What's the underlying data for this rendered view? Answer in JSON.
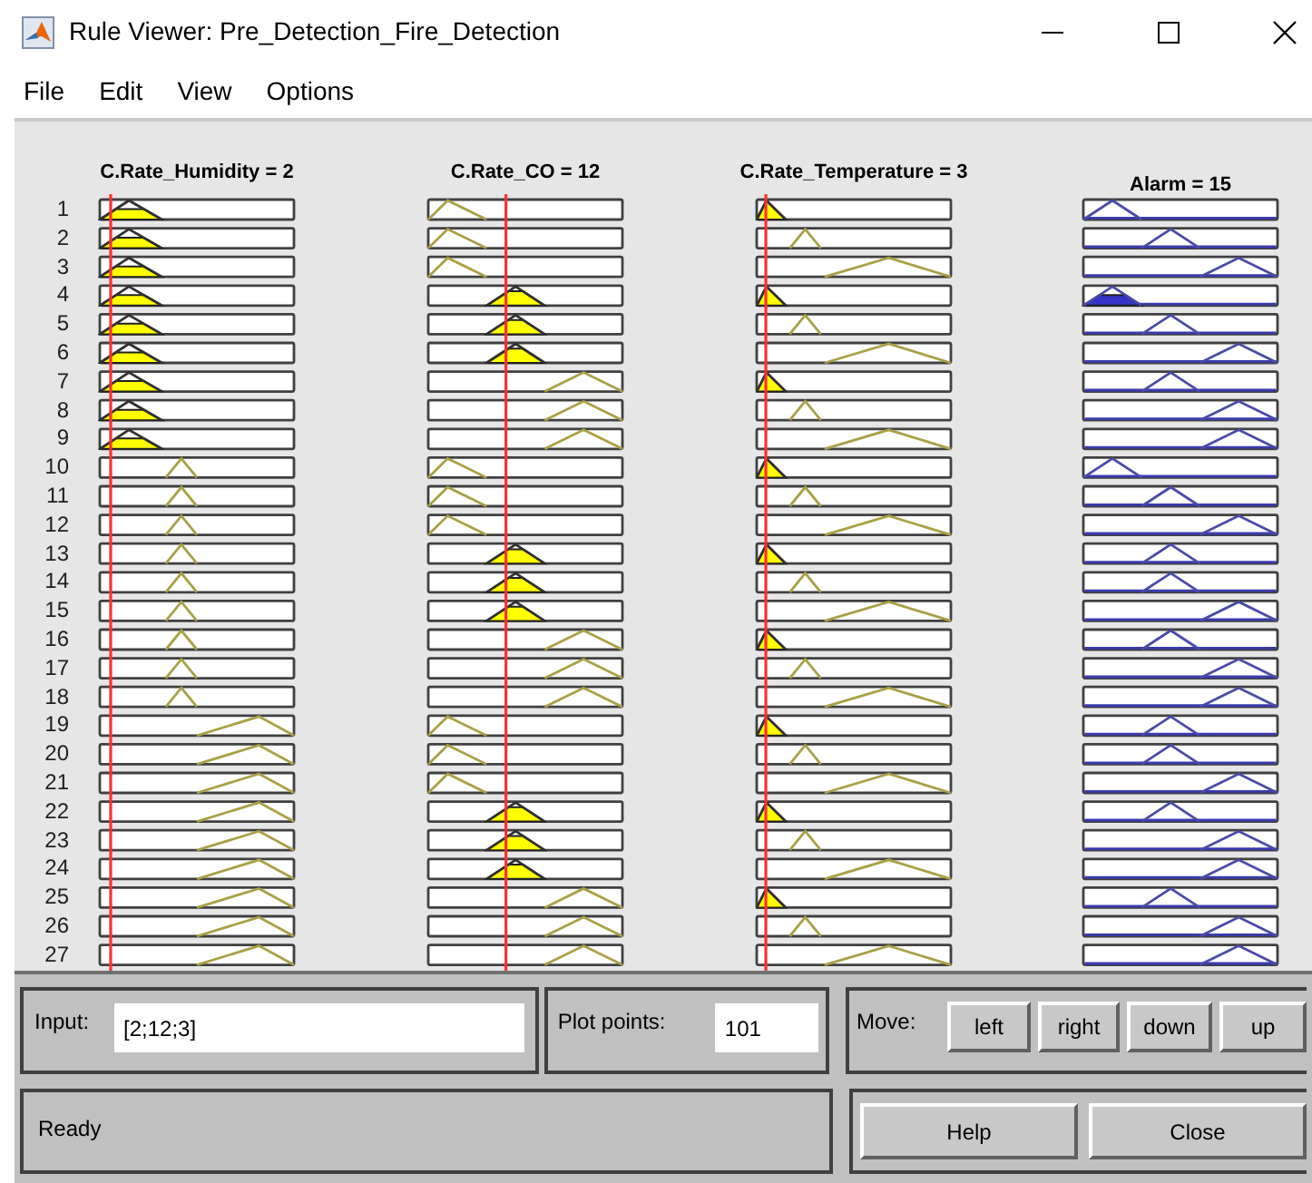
{
  "window": {
    "title": "Rule Viewer: Pre_Detection_Fire_Detection"
  },
  "menu": [
    "File",
    "Edit",
    "View",
    "Options"
  ],
  "columns": [
    {
      "title": "C.Rate_Humidity = 2",
      "input_line": true
    },
    {
      "title": "C.Rate_CO = 12",
      "input_line": true
    },
    {
      "title": "C.Rate_Temperature = 3",
      "input_line": true
    },
    {
      "title": "Alarm = 15"
    }
  ],
  "rules": [
    {
      "number": "1",
      "cells": [
        {
          "kind": "low",
          "fired": true
        },
        {
          "kind": "low",
          "fired": false
        },
        {
          "kind": "low",
          "fired": true
        },
        {
          "kind": "low",
          "fired": false
        }
      ]
    },
    {
      "number": "2",
      "cells": [
        {
          "kind": "low",
          "fired": true
        },
        {
          "kind": "low",
          "fired": false
        },
        {
          "kind": "mid",
          "fired": false
        },
        {
          "kind": "mid",
          "fired": false
        }
      ]
    },
    {
      "number": "3",
      "cells": [
        {
          "kind": "low",
          "fired": true
        },
        {
          "kind": "low",
          "fired": false
        },
        {
          "kind": "high",
          "fired": false
        },
        {
          "kind": "high",
          "fired": false
        }
      ]
    },
    {
      "number": "4",
      "cells": [
        {
          "kind": "low",
          "fired": true
        },
        {
          "kind": "mid",
          "fired": true
        },
        {
          "kind": "low",
          "fired": true
        },
        {
          "kind": "low",
          "fired": true
        }
      ]
    },
    {
      "number": "5",
      "cells": [
        {
          "kind": "low",
          "fired": true
        },
        {
          "kind": "mid",
          "fired": true
        },
        {
          "kind": "mid",
          "fired": false
        },
        {
          "kind": "mid",
          "fired": false
        }
      ]
    },
    {
      "number": "6",
      "cells": [
        {
          "kind": "low",
          "fired": true
        },
        {
          "kind": "mid",
          "fired": true
        },
        {
          "kind": "high",
          "fired": false
        },
        {
          "kind": "high",
          "fired": false
        }
      ]
    },
    {
      "number": "7",
      "cells": [
        {
          "kind": "low",
          "fired": true
        },
        {
          "kind": "high",
          "fired": false
        },
        {
          "kind": "low",
          "fired": true
        },
        {
          "kind": "mid",
          "fired": false
        }
      ]
    },
    {
      "number": "8",
      "cells": [
        {
          "kind": "low",
          "fired": true
        },
        {
          "kind": "high",
          "fired": false
        },
        {
          "kind": "mid",
          "fired": false
        },
        {
          "kind": "high",
          "fired": false
        }
      ]
    },
    {
      "number": "9",
      "cells": [
        {
          "kind": "low",
          "fired": true
        },
        {
          "kind": "high",
          "fired": false
        },
        {
          "kind": "high",
          "fired": false
        },
        {
          "kind": "high",
          "fired": false
        }
      ]
    },
    {
      "number": "10",
      "cells": [
        {
          "kind": "mid",
          "fired": false
        },
        {
          "kind": "low",
          "fired": false
        },
        {
          "kind": "low",
          "fired": true
        },
        {
          "kind": "low",
          "fired": false
        }
      ]
    },
    {
      "number": "11",
      "cells": [
        {
          "kind": "mid",
          "fired": false
        },
        {
          "kind": "low",
          "fired": false
        },
        {
          "kind": "mid",
          "fired": false
        },
        {
          "kind": "mid",
          "fired": false
        }
      ]
    },
    {
      "number": "12",
      "cells": [
        {
          "kind": "mid",
          "fired": false
        },
        {
          "kind": "low",
          "fired": false
        },
        {
          "kind": "high",
          "fired": false
        },
        {
          "kind": "high",
          "fired": false
        }
      ]
    },
    {
      "number": "13",
      "cells": [
        {
          "kind": "mid",
          "fired": false
        },
        {
          "kind": "mid",
          "fired": true
        },
        {
          "kind": "low",
          "fired": true
        },
        {
          "kind": "mid",
          "fired": false
        }
      ]
    },
    {
      "number": "14",
      "cells": [
        {
          "kind": "mid",
          "fired": false
        },
        {
          "kind": "mid",
          "fired": true
        },
        {
          "kind": "mid",
          "fired": false
        },
        {
          "kind": "mid",
          "fired": false
        }
      ]
    },
    {
      "number": "15",
      "cells": [
        {
          "kind": "mid",
          "fired": false
        },
        {
          "kind": "mid",
          "fired": true
        },
        {
          "kind": "high",
          "fired": false
        },
        {
          "kind": "high",
          "fired": false
        }
      ]
    },
    {
      "number": "16",
      "cells": [
        {
          "kind": "mid",
          "fired": false
        },
        {
          "kind": "high",
          "fired": false
        },
        {
          "kind": "low",
          "fired": true
        },
        {
          "kind": "mid",
          "fired": false
        }
      ]
    },
    {
      "number": "17",
      "cells": [
        {
          "kind": "mid",
          "fired": false
        },
        {
          "kind": "high",
          "fired": false
        },
        {
          "kind": "mid",
          "fired": false
        },
        {
          "kind": "high",
          "fired": false
        }
      ]
    },
    {
      "number": "18",
      "cells": [
        {
          "kind": "mid",
          "fired": false
        },
        {
          "kind": "high",
          "fired": false
        },
        {
          "kind": "high",
          "fired": false
        },
        {
          "kind": "high",
          "fired": false
        }
      ]
    },
    {
      "number": "19",
      "cells": [
        {
          "kind": "high",
          "fired": false
        },
        {
          "kind": "low",
          "fired": false
        },
        {
          "kind": "low",
          "fired": true
        },
        {
          "kind": "mid",
          "fired": false
        }
      ]
    },
    {
      "number": "20",
      "cells": [
        {
          "kind": "high",
          "fired": false
        },
        {
          "kind": "low",
          "fired": false
        },
        {
          "kind": "mid",
          "fired": false
        },
        {
          "kind": "mid",
          "fired": false
        }
      ]
    },
    {
      "number": "21",
      "cells": [
        {
          "kind": "high",
          "fired": false
        },
        {
          "kind": "low",
          "fired": false
        },
        {
          "kind": "high",
          "fired": false
        },
        {
          "kind": "high",
          "fired": false
        }
      ]
    },
    {
      "number": "22",
      "cells": [
        {
          "kind": "high",
          "fired": false
        },
        {
          "kind": "mid",
          "fired": true
        },
        {
          "kind": "low",
          "fired": true
        },
        {
          "kind": "mid",
          "fired": false
        }
      ]
    },
    {
      "number": "23",
      "cells": [
        {
          "kind": "high",
          "fired": false
        },
        {
          "kind": "mid",
          "fired": true
        },
        {
          "kind": "mid",
          "fired": false
        },
        {
          "kind": "high",
          "fired": false
        }
      ]
    },
    {
      "number": "24",
      "cells": [
        {
          "kind": "high",
          "fired": false
        },
        {
          "kind": "mid",
          "fired": true
        },
        {
          "kind": "high",
          "fired": false
        },
        {
          "kind": "high",
          "fired": false
        }
      ]
    },
    {
      "number": "25",
      "cells": [
        {
          "kind": "high",
          "fired": false
        },
        {
          "kind": "high",
          "fired": false
        },
        {
          "kind": "low",
          "fired": true
        },
        {
          "kind": "mid",
          "fired": false
        }
      ]
    },
    {
      "number": "26",
      "cells": [
        {
          "kind": "high",
          "fired": false
        },
        {
          "kind": "high",
          "fired": false
        },
        {
          "kind": "mid",
          "fired": false
        },
        {
          "kind": "high",
          "fired": false
        }
      ]
    },
    {
      "number": "27",
      "cells": [
        {
          "kind": "high",
          "fired": false
        },
        {
          "kind": "high",
          "fired": false
        },
        {
          "kind": "high",
          "fired": false
        },
        {
          "kind": "high",
          "fired": false
        }
      ]
    }
  ],
  "input": {
    "label": "Input:",
    "value": "[2;12;3]"
  },
  "plot_points": {
    "label": "Plot points:",
    "value": "101"
  },
  "move": {
    "label": "Move:",
    "buttons": [
      "left",
      "right",
      "down",
      "up"
    ]
  },
  "status": "Ready",
  "buttons": [
    "Help",
    "Close"
  ]
}
